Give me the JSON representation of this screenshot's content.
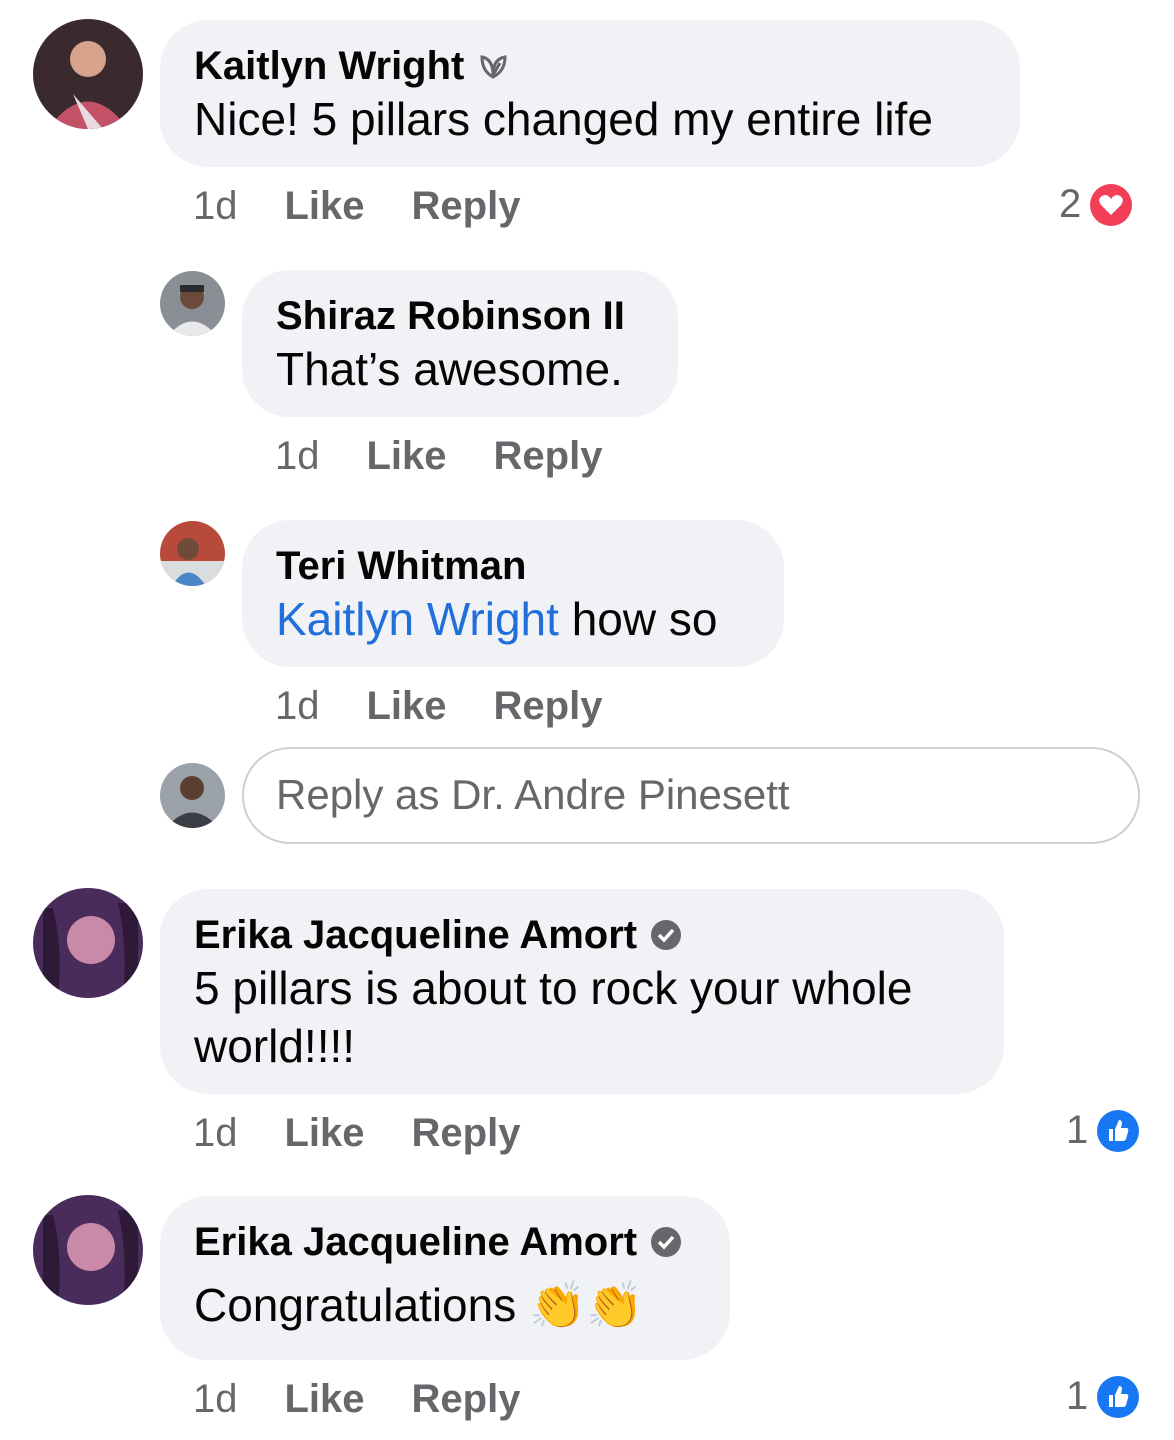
{
  "comments": [
    {
      "author": "Kaitlyn Wright",
      "badge": "leaf-badge-icon",
      "text": "Nice! 5 pillars changed my entire life",
      "time": "1d",
      "like_label": "Like",
      "reply_label": "Reply",
      "reaction_count": "2",
      "reaction_type": "love"
    },
    {
      "author": "Shiraz Robinson II",
      "text": "That’s awesome.",
      "time": "1d",
      "like_label": "Like",
      "reply_label": "Reply"
    },
    {
      "author": "Teri Whitman",
      "mention": "Kaitlyn Wright",
      "text": " how so",
      "time": "1d",
      "like_label": "Like",
      "reply_label": "Reply"
    },
    {
      "author": "Erika Jacqueline Amort",
      "badge": "verified-shield-icon",
      "text": "5 pillars is about to rock your whole world!!!!",
      "time": "1d",
      "like_label": "Like",
      "reply_label": "Reply",
      "reaction_count": "1",
      "reaction_type": "like"
    },
    {
      "author": "Erika Jacqueline Amort",
      "badge": "verified-shield-icon",
      "text": "Congratulations 👏👏",
      "time": "1d",
      "like_label": "Like",
      "reply_label": "Reply",
      "reaction_count": "1",
      "reaction_type": "like"
    }
  ],
  "reply_input": {
    "placeholder": "Reply as Dr. Andre Pinesett"
  },
  "colors": {
    "bubble_bg": "#f0f2f5",
    "secondary_text": "#65676b",
    "mention": "#216fdb",
    "like_blue": "#1877f2",
    "love_red": "#f33e58"
  }
}
